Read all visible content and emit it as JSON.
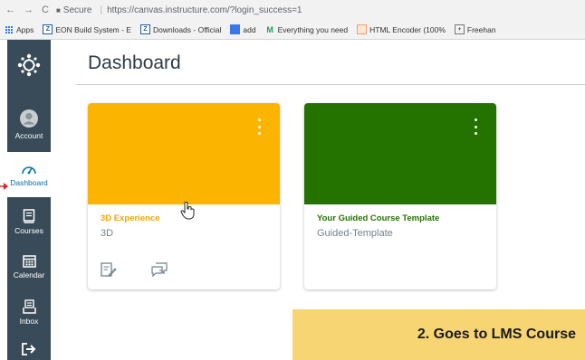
{
  "browser": {
    "secure_label": "Secure",
    "separator": "|",
    "url": "https://canvas.instructure.com/?login_success=1",
    "bookmarks": [
      {
        "label": "Apps",
        "icon": "apps-grid-icon"
      },
      {
        "label": "EON Build System - E",
        "icon": "z-icon"
      },
      {
        "label": "Downloads - Official",
        "icon": "z-icon"
      },
      {
        "label": "add",
        "icon": "blue-square-icon"
      },
      {
        "label": "Everything you need",
        "icon": "m-icon"
      },
      {
        "label": "HTML Encoder (100%",
        "icon": "code-icon"
      },
      {
        "label": "Freehan",
        "icon": "image-icon"
      }
    ]
  },
  "sidebar": {
    "items": [
      {
        "label": "Account",
        "icon": "account-icon"
      },
      {
        "label": "Dashboard",
        "icon": "dashboard-icon",
        "active": true
      },
      {
        "label": "Courses",
        "icon": "courses-icon"
      },
      {
        "label": "Calendar",
        "icon": "calendar-icon"
      },
      {
        "label": "Inbox",
        "icon": "inbox-icon"
      }
    ]
  },
  "main": {
    "title": "Dashboard",
    "cards": [
      {
        "name": "3D Experience",
        "code": "3D",
        "hero_color": "#fbb500",
        "name_color": "#f2a500"
      },
      {
        "name": "Your Guided Course Template",
        "code": "Guided-Template",
        "hero_color": "#247300",
        "name_color": "#247300"
      }
    ]
  },
  "callout": {
    "text": "2. Goes to LMS Course"
  },
  "colors": {
    "sidebar_bg": "#394b58",
    "active_text": "#0770a3",
    "callout_bg": "#f7d572",
    "arrow": "#e02020"
  }
}
